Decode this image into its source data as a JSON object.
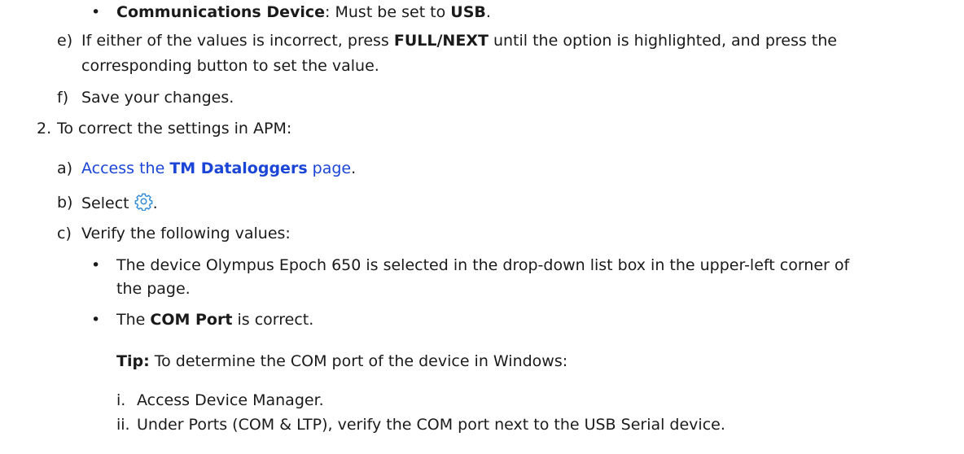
{
  "bullet_char": "•",
  "step1": {
    "comm_bullet": {
      "label": "Communications Device",
      "text_mid": ": Must be set to ",
      "value": "USB",
      "text_end": "."
    },
    "e": {
      "marker": "e)",
      "text_a": "If either of the values is incorrect, press ",
      "bold": "FULL/NEXT",
      "text_b": " until the option is highlighted, and press the",
      "line2": "corresponding button to set the value."
    },
    "f": {
      "marker": "f)",
      "text": "Save your changes."
    }
  },
  "step2": {
    "marker": "2.",
    "text": "To correct the settings in APM:",
    "a": {
      "marker": "a)",
      "link_pre": "Access the ",
      "link_bold": "TM Dataloggers",
      "link_post": " page",
      "end": "."
    },
    "b": {
      "marker": "b)",
      "text": "Select ",
      "icon": "settings-gear-icon",
      "end": "."
    },
    "c": {
      "marker": "c)",
      "text": "Verify the following values:",
      "bullet1_line1": "The device Olympus Epoch 650 is selected in the drop-down list box in the upper-left corner of",
      "bullet1_line2": "the page.",
      "bullet2": {
        "pre": "The ",
        "bold": "COM Port",
        "post": " is correct."
      },
      "tip": {
        "label": "Tip:",
        "text": " To determine the COM port of the device in Windows:"
      },
      "sub": [
        {
          "marker": "i.",
          "text": "Access Device Manager."
        },
        {
          "marker": "ii.",
          "text": "Under Ports (COM & LTP), verify the COM port next to the USB Serial device."
        }
      ]
    }
  },
  "colors": {
    "text": "#1a1a1a",
    "link": "#1a45d6",
    "icon": "#3b8fd9"
  }
}
